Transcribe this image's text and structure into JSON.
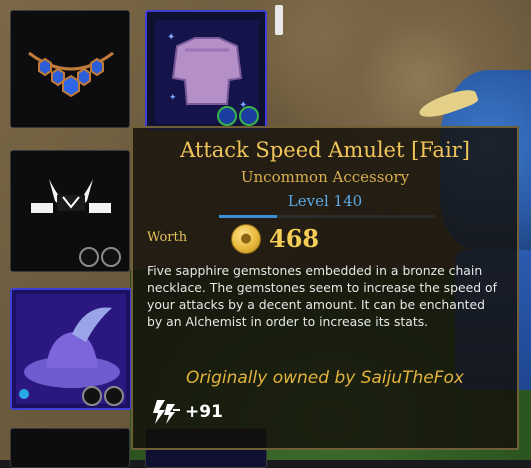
{
  "tooltip": {
    "item_name": "Attack Speed Amulet [Fair]",
    "rarity_type": "Uncommon Accessory",
    "level": "Level 140",
    "level_progress": 0.27,
    "worth_label": "Worth",
    "worth_value": "468",
    "description": "Five sapphire gemstones embedded in a bronze chain necklace. The gemstones seem to increase the speed of your attacks by a decent amount. It can be enchanted by an Alchemist in order to increase its stats.",
    "owner": "Originally owned by SaijuTheFox",
    "stat_value": "+91",
    "stat_icon": "attack-speed-icon"
  },
  "inventory": {
    "slots": [
      {
        "item": "sapphire-amulet",
        "selected": false
      },
      {
        "item": "purple-chest-armor",
        "selected": true
      },
      {
        "item": "white-horned-helmet",
        "selected": false
      },
      {
        "item": "purple-feathered-hat",
        "selected": true
      }
    ]
  },
  "colors": {
    "title_gold": "#f0c55a",
    "level_blue": "#5aa8e6",
    "owner_gold": "#e2b33c",
    "selection_blue": "#3f3fd6"
  }
}
